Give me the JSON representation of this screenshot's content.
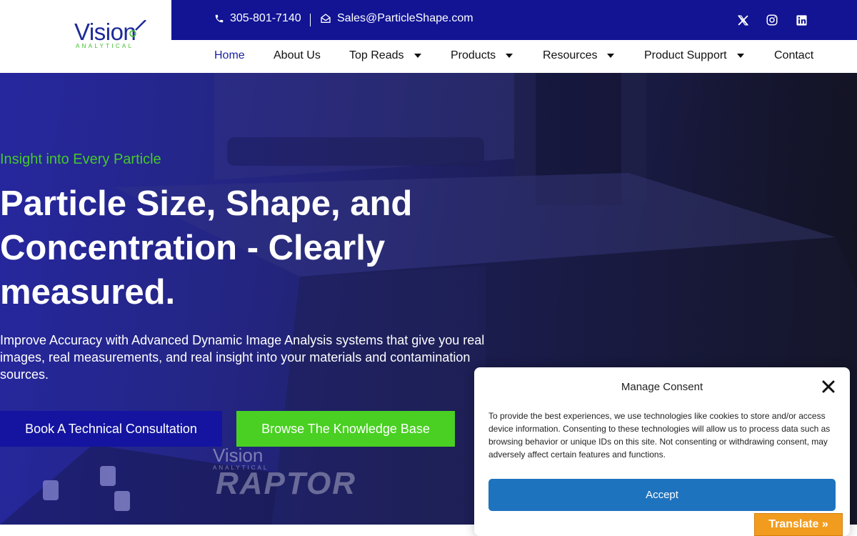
{
  "brand": {
    "logo_text": "Vision",
    "logo_subtext": "ANALYTICAL",
    "colors": {
      "navy": "#121494",
      "green": "#49d022",
      "accept_blue": "#1e73be",
      "translate_orange": "#f29c1f"
    }
  },
  "topbar": {
    "phone": "305-801-7140",
    "phone_icon": "phone-icon",
    "email": "Sales@ParticleShape.com",
    "email_icon": "mail-open-icon",
    "social_icons": [
      "x-twitter-icon",
      "instagram-icon",
      "linkedin-icon"
    ]
  },
  "nav": {
    "items": [
      {
        "label": "Home",
        "active": true,
        "dropdown": false
      },
      {
        "label": "About Us",
        "dropdown": false
      },
      {
        "label": "Top Reads",
        "dropdown": true
      },
      {
        "label": "Products",
        "dropdown": true
      },
      {
        "label": "Resources",
        "dropdown": true
      },
      {
        "label": "Product Support",
        "dropdown": true
      },
      {
        "label": "Contact",
        "dropdown": false
      }
    ]
  },
  "hero": {
    "tagline": "Insight into Every Particle",
    "headline": "Particle Size, Shape, and Concentration - Clearly measured.",
    "subtext": "Improve Accuracy with Advanced Dynamic Image Analysis systems that give you real images, real measurements, and real insight into your materials and contamination sources.",
    "primary_button": "Book A Technical Consultation",
    "secondary_button": "Browse The Knowledge Base",
    "image_brand_text": "Vision",
    "image_brand_sub": "ANALYTICAL",
    "image_model_text": "RAPTOR"
  },
  "consent": {
    "title": "Manage Consent",
    "body": "To provide the best experiences, we use technologies like cookies to store and/or access device information. Consenting to these technologies will allow us to process data such as browsing behavior or unique IDs on this site. Not consenting or withdrawing consent, may adversely affect certain features and functions.",
    "accept_label": "Accept",
    "close_icon": "close-icon"
  },
  "translate": {
    "label": "Translate »"
  }
}
